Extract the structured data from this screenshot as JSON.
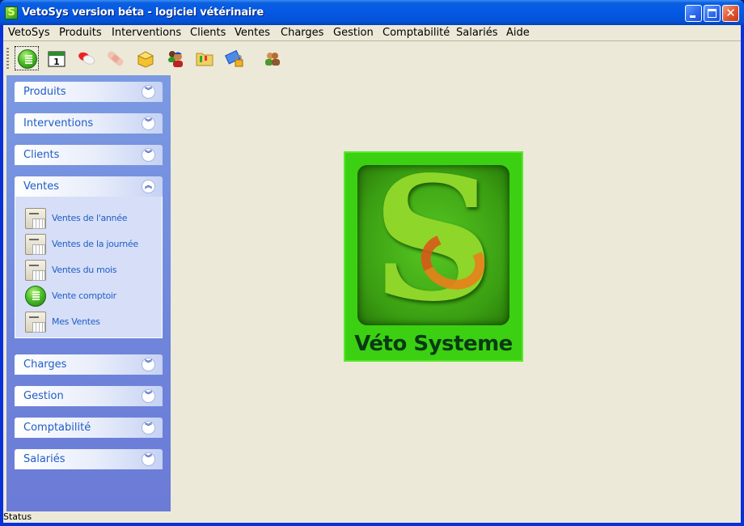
{
  "window": {
    "title": "VetoSys version béta - logiciel vétérinaire",
    "controls": [
      "minimize",
      "maximize",
      "close"
    ]
  },
  "menubar": {
    "items": [
      "VetoSys",
      "Produits",
      "Interventions",
      "Clients",
      "Ventes",
      "Charges",
      "Gestion",
      "Comptabilité",
      "Salariés",
      "Aide"
    ]
  },
  "toolbar": {
    "tools": [
      {
        "icon": "calculator-icon",
        "active": true
      },
      {
        "icon": "calendar-icon",
        "glyph": "1"
      },
      {
        "icon": "pill-icon"
      },
      {
        "icon": "bandage-icon"
      },
      {
        "icon": "box-icon"
      },
      {
        "icon": "users-icon"
      },
      {
        "icon": "folder-icon"
      },
      {
        "icon": "lock-icon"
      },
      {
        "icon": "people-icon"
      }
    ]
  },
  "sidebar": {
    "groups": [
      {
        "label": "Produits",
        "expanded": false
      },
      {
        "label": "Interventions",
        "expanded": false
      },
      {
        "label": "Clients",
        "expanded": false
      },
      {
        "label": "Ventes",
        "expanded": true,
        "tasks": [
          {
            "label": "Ventes de l'année",
            "icon": "report-icon"
          },
          {
            "label": "Ventes de la journée",
            "icon": "report-icon"
          },
          {
            "label": "Ventes du mois",
            "icon": "report-icon"
          },
          {
            "label": "Vente comptoir",
            "icon": "calculator-icon"
          },
          {
            "label": "Mes Ventes",
            "icon": "report-icon"
          }
        ]
      },
      {
        "label": "Charges",
        "expanded": false
      },
      {
        "label": "Gestion",
        "expanded": false
      },
      {
        "label": "Comptabilité",
        "expanded": false
      },
      {
        "label": "Salariés",
        "expanded": false
      }
    ],
    "chevron_down": "︾",
    "chevron_up": "︽"
  },
  "logo": {
    "letter": "S",
    "text": "Véto Systeme"
  },
  "statusbar": {
    "text": "Status"
  },
  "colors": {
    "title_bar": "#0558e4",
    "sidebar_bg": "#7b9ae2",
    "link_text": "#215dc6",
    "logo_green": "#3cd012",
    "client_bg": "#ece9d8"
  }
}
